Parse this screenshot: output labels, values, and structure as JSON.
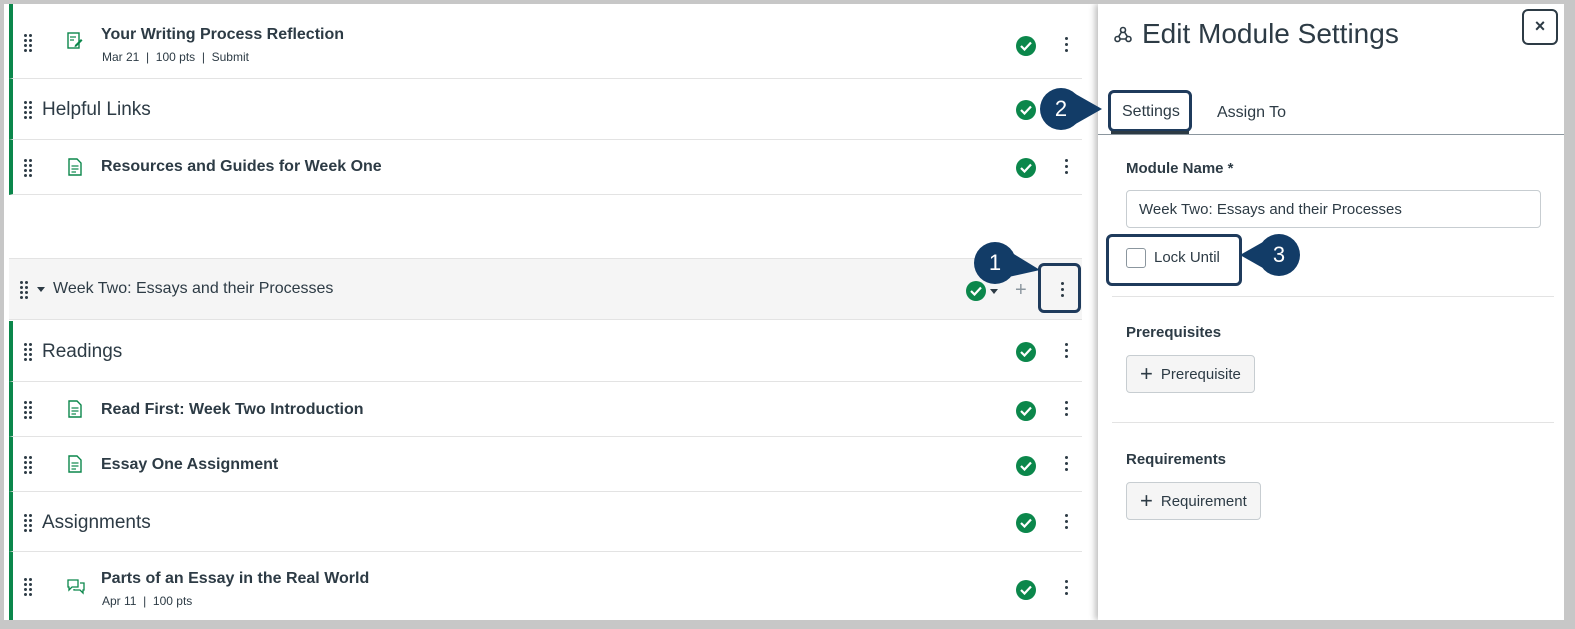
{
  "modules_list": {
    "items": [
      {
        "type": "assignment",
        "title": "Your Writing Process Reflection",
        "meta": "Mar 21  |  100 pts  |  Submit"
      },
      {
        "type": "header",
        "title": "Helpful Links"
      },
      {
        "type": "page",
        "title": "Resources and Guides for Week One"
      },
      {
        "type": "header",
        "title": "Readings"
      },
      {
        "type": "page",
        "title": "Read First: Week Two Introduction"
      },
      {
        "type": "page",
        "title": "Essay One Assignment"
      },
      {
        "type": "header",
        "title": "Assignments"
      },
      {
        "type": "discussion",
        "title": "Parts of an Essay in the Real World",
        "meta": "Apr 11  |  100 pts"
      }
    ],
    "module": {
      "title": "Week Two: Essays and their Processes",
      "add_symbol": "+"
    }
  },
  "callouts": {
    "one": "1",
    "two": "2",
    "three": "3"
  },
  "panel": {
    "title": "Edit Module Settings",
    "close_symbol": "×",
    "tabs": [
      {
        "label": "Settings",
        "active": true
      },
      {
        "label": "Assign To",
        "active": false
      }
    ],
    "module_name_label": "Module Name *",
    "module_name_value": "Week Two: Essays and their Processes",
    "lock_until_label": "Lock Until",
    "prerequisites_label": "Prerequisites",
    "prerequisite_button": "Prerequisite",
    "requirements_label": "Requirements",
    "requirement_button": "Requirement",
    "plus_symbol": "+"
  },
  "icons": [
    "drag-handle-icon",
    "assignment-icon",
    "page-icon",
    "discussion-icon",
    "published-check-icon",
    "kebab-menu-icon",
    "module-icon",
    "close-icon",
    "plus-icon"
  ],
  "colors": {
    "published_green": "#0b874b",
    "callout_navy": "#123c67",
    "highlight_border": "#1f3b5c",
    "text": "#2d3b45"
  }
}
